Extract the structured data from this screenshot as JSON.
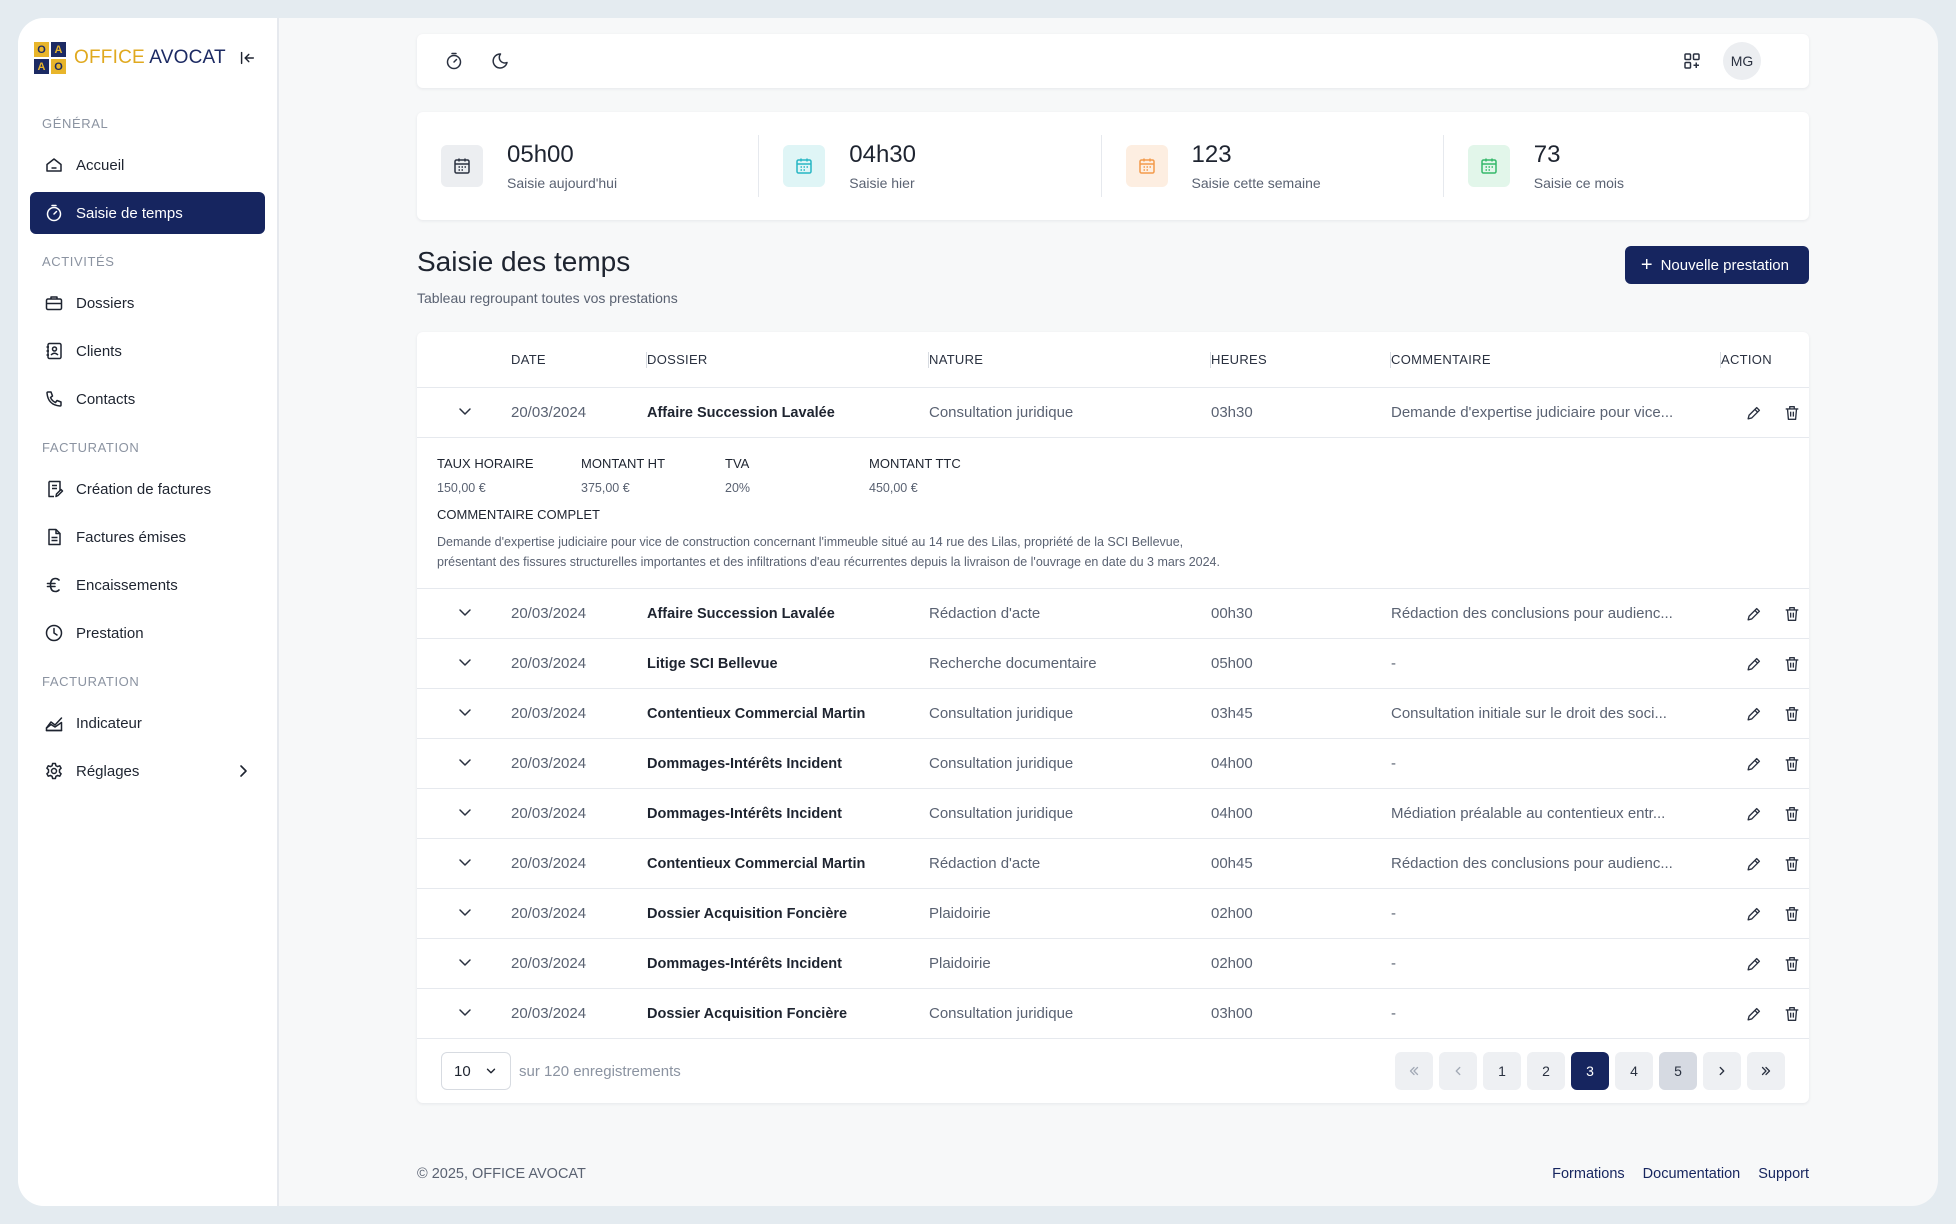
{
  "brand": {
    "logo_letters": [
      "O",
      "A",
      "A",
      "O"
    ],
    "name_part1": "OFFICE ",
    "name_part2": "AVOCAT",
    "logo_colors": {
      "yellow": "#e8b52b",
      "navy": "#1c2a63"
    }
  },
  "sidebar": {
    "sections": [
      {
        "title": "GÉNÉRAL",
        "items": [
          {
            "label": "Accueil",
            "icon": "home-icon"
          },
          {
            "label": "Saisie de temps",
            "icon": "stopwatch-icon",
            "active": true
          }
        ]
      },
      {
        "title": "ACTIVITÉS",
        "items": [
          {
            "label": "Dossiers",
            "icon": "briefcase-icon"
          },
          {
            "label": "Clients",
            "icon": "contact-card-icon"
          },
          {
            "label": "Contacts",
            "icon": "phone-icon"
          }
        ]
      },
      {
        "title": "FACTURATION",
        "items": [
          {
            "label": "Création de factures",
            "icon": "invoice-create-icon"
          },
          {
            "label": "Factures émises",
            "icon": "document-icon"
          },
          {
            "label": "Encaissements",
            "icon": "euro-icon"
          },
          {
            "label": "Prestation",
            "icon": "clock-icon"
          }
        ]
      },
      {
        "title": "FACTURATION",
        "items": [
          {
            "label": "Indicateur",
            "icon": "chart-line-icon"
          },
          {
            "label": "Réglages",
            "icon": "gear-icon"
          }
        ]
      }
    ]
  },
  "topbar": {
    "user_initials": "MG",
    "icons": [
      "stopwatch-icon",
      "moon-icon",
      "apps-icon"
    ]
  },
  "stats": [
    {
      "value": "05h00",
      "label": "Saisie aujourd'hui",
      "bg": "#eceef1",
      "fg": "#2a3140"
    },
    {
      "value": "04h30",
      "label": "Saisie hier",
      "bg": "#dff5f6",
      "fg": "#27b6c4"
    },
    {
      "value": "123",
      "label": "Saisie cette semaine",
      "bg": "#fdeee1",
      "fg": "#f39a4a"
    },
    {
      "value": "73",
      "label": "Saisie ce mois",
      "bg": "#e2f6ea",
      "fg": "#34b86a"
    }
  ],
  "page": {
    "title": "Saisie des temps",
    "subtitle": "Tableau regroupant toutes vos prestations",
    "new_button": "Nouvelle prestation"
  },
  "table": {
    "headers": {
      "date": "DATE",
      "dossier": "DOSSIER",
      "nature": "NATURE",
      "heures": "HEURES",
      "commentaire": "COMMENTAIRE",
      "action": "ACTION"
    },
    "first_row": {
      "date": "20/03/2024",
      "dossier": "Affaire Succession Lavalée",
      "nature": "Consultation juridique",
      "heures": "03h30",
      "commentaire": "Demande d'expertise judiciaire pour vice..."
    },
    "details": {
      "taux_label": "TAUX HORAIRE",
      "taux_value": "150,00 €",
      "ht_label": "MONTANT HT",
      "ht_value": "375,00 €",
      "tva_label": "TVA",
      "tva_value": "20%",
      "ttc_label": "MONTANT TTC",
      "ttc_value": "450,00 €",
      "comment_title": "COMMENTAIRE COMPLET",
      "comment_text": "Demande d'expertise judiciaire pour vice de construction concernant l'immeuble situé au 14 rue des Lilas, propriété de la SCI Bellevue, présentant des fissures structurelles importantes et des infiltrations d'eau récurrentes depuis la livraison de l'ouvrage en date du 3 mars 2024."
    },
    "rows": [
      {
        "date": "20/03/2024",
        "dossier": "Affaire Succession Lavalée",
        "nature": "Rédaction d'acte",
        "heures": "00h30",
        "commentaire": "Rédaction des conclusions pour audienc..."
      },
      {
        "date": "20/03/2024",
        "dossier": "Litige SCI Bellevue",
        "nature": "Recherche documentaire",
        "heures": "05h00",
        "commentaire": "-"
      },
      {
        "date": "20/03/2024",
        "dossier": "Contentieux Commercial Martin",
        "nature": "Consultation juridique",
        "heures": "03h45",
        "commentaire": "Consultation initiale sur le droit des soci..."
      },
      {
        "date": "20/03/2024",
        "dossier": "Dommages-Intérêts Incident",
        "nature": "Consultation juridique",
        "heures": "04h00",
        "commentaire": "-"
      },
      {
        "date": "20/03/2024",
        "dossier": "Dommages-Intérêts Incident",
        "nature": "Consultation juridique",
        "heures": "04h00",
        "commentaire": "Médiation préalable au contentieux entr..."
      },
      {
        "date": "20/03/2024",
        "dossier": "Contentieux Commercial Martin",
        "nature": "Rédaction d'acte",
        "heures": "00h45",
        "commentaire": "Rédaction des conclusions pour audienc..."
      },
      {
        "date": "20/03/2024",
        "dossier": "Dossier Acquisition Foncière",
        "nature": "Plaidoirie",
        "heures": "02h00",
        "commentaire": "-"
      },
      {
        "date": "20/03/2024",
        "dossier": "Dommages-Intérêts Incident",
        "nature": "Plaidoirie",
        "heures": "02h00",
        "commentaire": "-"
      },
      {
        "date": "20/03/2024",
        "dossier": "Dossier Acquisition Foncière",
        "nature": "Consultation juridique",
        "heures": "03h00",
        "commentaire": "-"
      }
    ]
  },
  "pagination": {
    "page_size": "10",
    "records_text": "sur 120 enregistrements",
    "pages": [
      "1",
      "2",
      "3",
      "4",
      "5"
    ],
    "current": "3"
  },
  "footer": {
    "copyright": "© 2025, OFFICE AVOCAT",
    "links": [
      "Formations",
      "Documentation",
      "Support"
    ]
  }
}
